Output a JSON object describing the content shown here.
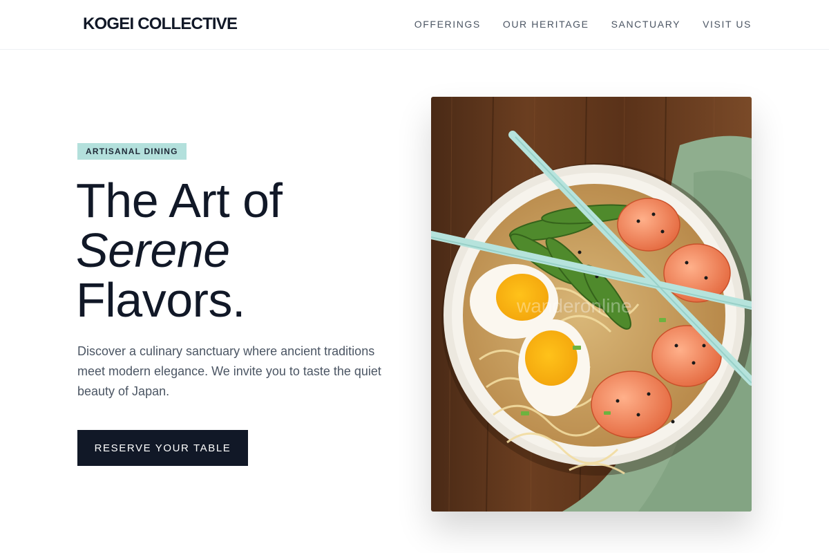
{
  "header": {
    "logo": "KOGEI COLLECTIVE",
    "nav": [
      "OFFERINGS",
      "OUR HERITAGE",
      "SANCTUARY",
      "VISIT US"
    ]
  },
  "hero": {
    "badge": "ARTISANAL DINING",
    "headline_line1": "The Art of",
    "headline_italic": "Serene",
    "headline_line3": "Flavors.",
    "description": "Discover a culinary sanctuary where ancient traditions meet modern elegance. We invite you to taste the quiet beauty of Japan.",
    "cta_label": "RESERVE YOUR TABLE"
  },
  "image": {
    "subject": "ramen-bowl-photo",
    "watermark": "wanderonline"
  },
  "colors": {
    "text_dark": "#111827",
    "text_muted": "#4b5563",
    "badge_bg": "#b3e0dc",
    "button_bg": "#111827"
  }
}
